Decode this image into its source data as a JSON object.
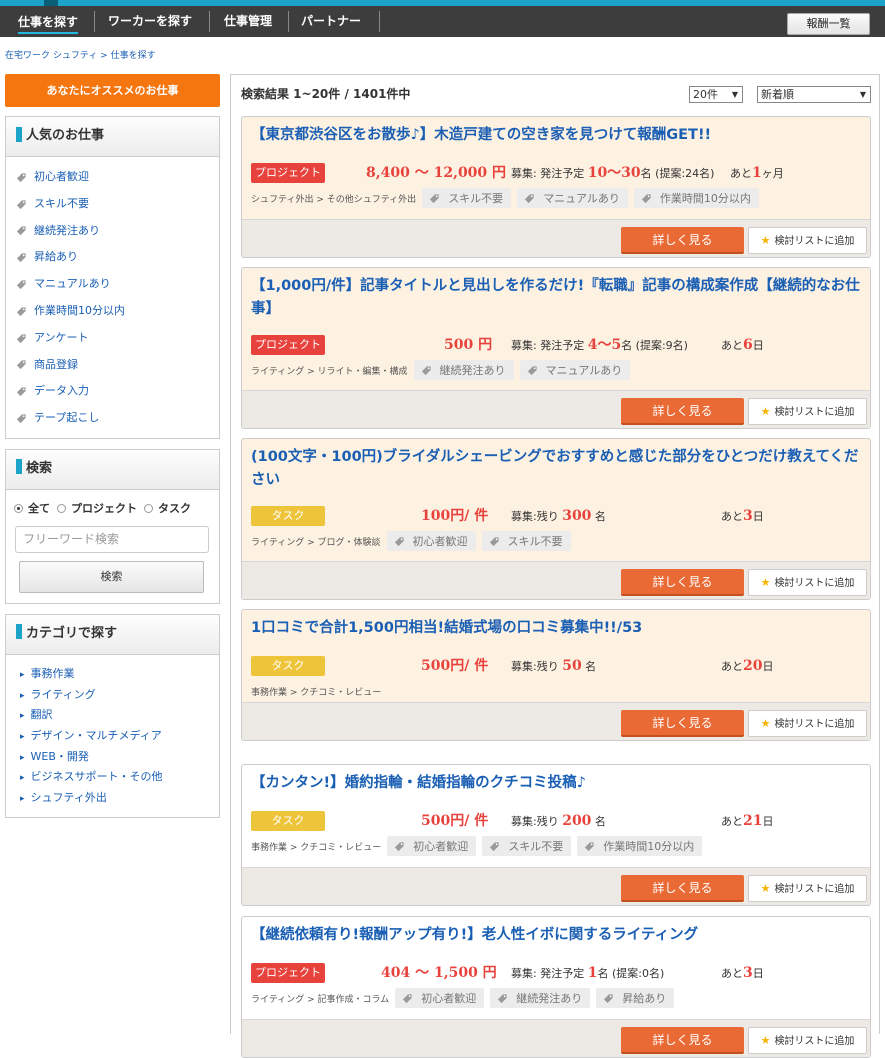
{
  "nav": {
    "items": [
      "仕事を探す",
      "ワーカーを探す",
      "仕事管理",
      "パートナー"
    ],
    "reward_list": "報酬一覧"
  },
  "breadcrumb": "在宅ワーク シュフティ > 仕事を探す",
  "sidebar": {
    "recommend": "あなたにオススメのお仕事",
    "popular": {
      "title": "人気のお仕事",
      "items": [
        "初心者歓迎",
        "スキル不要",
        "継続発注あり",
        "昇給あり",
        "マニュアルあり",
        "作業時間10分以内",
        "アンケート",
        "商品登録",
        "データ入力",
        "テープ起こし"
      ]
    },
    "search": {
      "title": "検索",
      "options": [
        "全て",
        "プロジェクト",
        "タスク"
      ],
      "placeholder": "フリーワード検索",
      "button": "検索"
    },
    "category": {
      "title": "カテゴリで探す",
      "items": [
        "事務作業",
        "ライティング",
        "翻訳",
        "デザイン・マルチメディア",
        "WEB・開発",
        "ビジネスサポート・その他",
        "シュフティ外出"
      ]
    }
  },
  "results": {
    "summary": "検索結果 1~20件 / 1401件中",
    "per_page": "20件",
    "sort": "新着順"
  },
  "buttons": {
    "detail": "詳しく見る",
    "favorite": "検討リストに追加"
  },
  "jobs": [
    {
      "title": "【東京都渋谷区をお散歩♪】木造戸建ての空き家を見つけて報酬GET!!",
      "type": "プロジェクト",
      "price": "8,400 ～ 12,000 円",
      "recruit_prefix": "募集: 発注予定 ",
      "recruit_value": "10～30",
      "recruit_suffix": "名 (提案:24名)",
      "remain_prefix": "あと",
      "remain_value": "1",
      "remain_suffix": "ヶ月",
      "category": "シュフティ外出 > その他シュフティ外出",
      "tags": [
        "スキル不要",
        "マニュアルあり",
        "作業時間10分以内"
      ]
    },
    {
      "title": "【1,000円/件】記事タイトルと見出しを作るだけ!『転職』記事の構成案作成【継続的なお仕事】",
      "type": "プロジェクト",
      "price": "500 円",
      "recruit_prefix": "募集: 発注予定 ",
      "recruit_value": "4～5",
      "recruit_suffix": "名 (提案:9名)",
      "remain_prefix": "あと",
      "remain_value": "6",
      "remain_suffix": "日",
      "category": "ライティング > リライト・編集・構成",
      "tags": [
        "継続発注あり",
        "マニュアルあり"
      ]
    },
    {
      "title": "(100文字・100円)ブライダルシェービングでおすすめと感じた部分をひとつだけ教えてください",
      "type": "タスク",
      "price": "100円/ 件",
      "recruit_prefix": "募集:残り ",
      "recruit_value": "300",
      "recruit_suffix": " 名",
      "remain_prefix": "あと",
      "remain_value": "3",
      "remain_suffix": "日",
      "category": "ライティング > ブログ・体験談",
      "tags": [
        "初心者歓迎",
        "スキル不要"
      ]
    },
    {
      "title": "1口コミで合計1,500円相当!結婚式場の口コミ募集中!!/53",
      "type": "タスク",
      "price": "500円/ 件",
      "recruit_prefix": "募集:残り ",
      "recruit_value": "50",
      "recruit_suffix": " 名",
      "remain_prefix": "あと",
      "remain_value": "20",
      "remain_suffix": "日",
      "category": "事務作業 > クチコミ・レビュー",
      "tags": []
    },
    {
      "title": "【カンタン!】婚約指輪・結婚指輪のクチコミ投稿♪",
      "type": "タスク",
      "price": "500円/ 件",
      "recruit_prefix": "募集:残り ",
      "recruit_value": "200",
      "recruit_suffix": " 名",
      "remain_prefix": "あと",
      "remain_value": "21",
      "remain_suffix": "日",
      "category": "事務作業 > クチコミ・レビュー",
      "tags": [
        "初心者歓迎",
        "スキル不要",
        "作業時間10分以内"
      ]
    },
    {
      "title": "【継続依頼有り!報酬アップ有り!】老人性イボに関するライティング",
      "type": "プロジェクト",
      "price": "404 ～ 1,500 円",
      "recruit_prefix": "募集: 発注予定 ",
      "recruit_value": "1",
      "recruit_suffix": "名 (提案:0名)",
      "remain_prefix": "あと",
      "remain_value": "3",
      "remain_suffix": "日",
      "category": "ライティング > 記事作成・コラム",
      "tags": [
        "初心者歓迎",
        "継続発注あり",
        "昇給あり"
      ]
    }
  ]
}
